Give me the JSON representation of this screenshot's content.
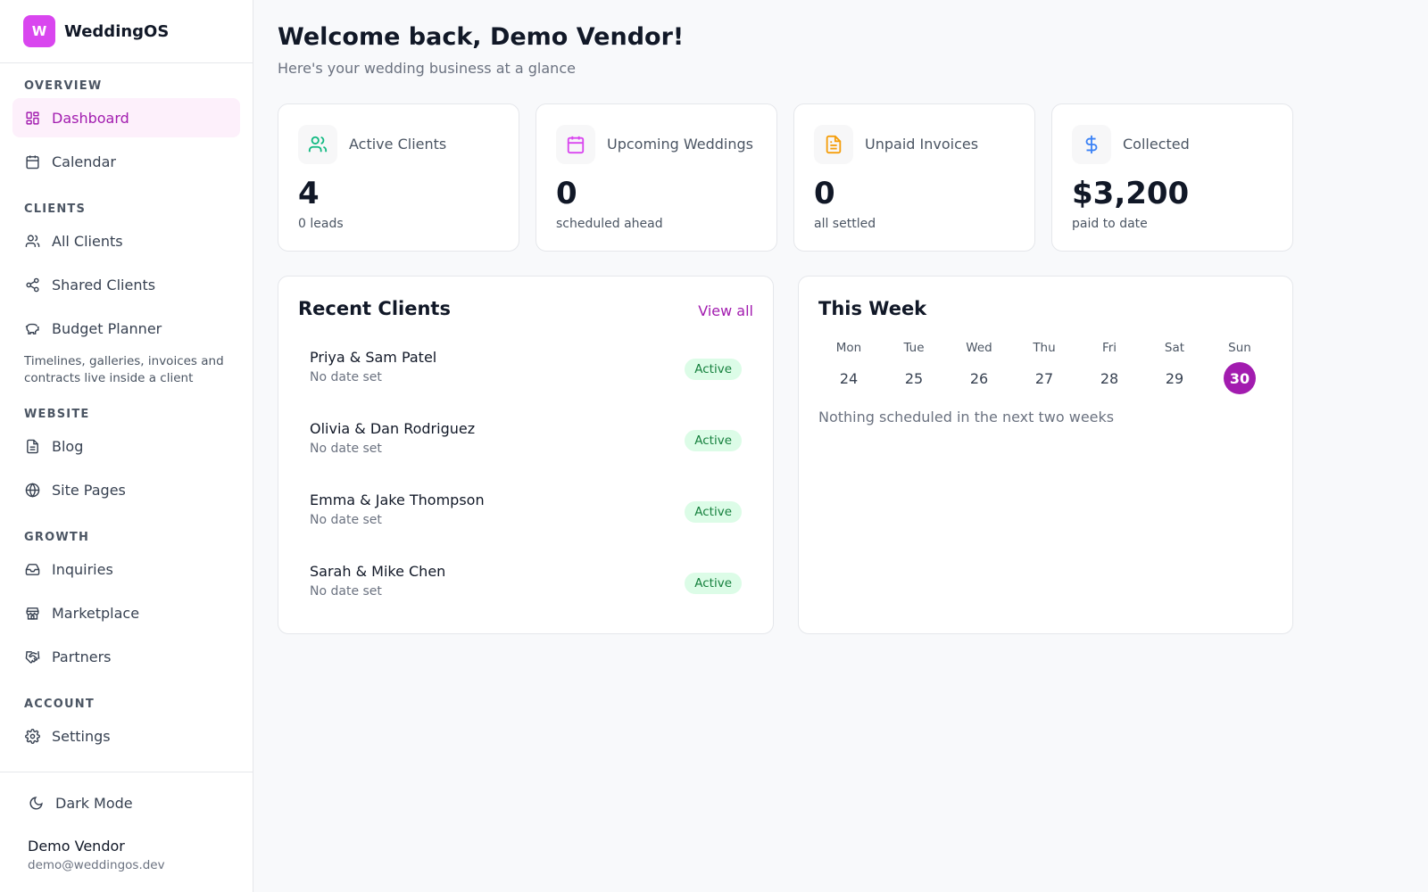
{
  "brand": {
    "logo_letter": "W",
    "name": "WeddingOS",
    "accent": "#d946ef"
  },
  "sidebar": {
    "sections": {
      "overview": "OVERVIEW",
      "clients": "CLIENTS",
      "website": "WEBSITE",
      "growth": "GROWTH",
      "account": "ACCOUNT"
    },
    "items": {
      "dashboard": {
        "label": "Dashboard",
        "icon": "dashboard-grid-icon",
        "active": true
      },
      "calendar": {
        "label": "Calendar",
        "icon": "calendar-icon"
      },
      "all_clients": {
        "label": "All Clients",
        "icon": "users-icon"
      },
      "shared_clients": {
        "label": "Shared Clients",
        "icon": "share-icon"
      },
      "budget_planner": {
        "label": "Budget Planner",
        "icon": "piggy-bank-icon"
      },
      "blog": {
        "label": "Blog",
        "icon": "document-icon"
      },
      "site_pages": {
        "label": "Site Pages",
        "icon": "globe-icon"
      },
      "inquiries": {
        "label": "Inquiries",
        "icon": "inbox-icon"
      },
      "marketplace": {
        "label": "Marketplace",
        "icon": "store-icon"
      },
      "partners": {
        "label": "Partners",
        "icon": "handshake-icon"
      },
      "settings": {
        "label": "Settings",
        "icon": "gear-icon"
      }
    },
    "note": "Timelines, galleries, invoices and contracts live inside a client",
    "dark_mode": {
      "label": "Dark Mode",
      "icon": "moon-icon"
    },
    "user": {
      "name": "Demo Vendor",
      "email": "demo@weddingos.dev"
    }
  },
  "header": {
    "title": "Welcome back, Demo Vendor!",
    "subtitle": "Here's your wedding business at a glance"
  },
  "stats": [
    {
      "label": "Active Clients",
      "value": "4",
      "sub": "0 leads",
      "icon": "users-icon",
      "color": "#10b981"
    },
    {
      "label": "Upcoming Weddings",
      "value": "0",
      "sub": "scheduled ahead",
      "icon": "calendar-icon",
      "color": "#d946ef"
    },
    {
      "label": "Unpaid Invoices",
      "value": "0",
      "sub": "all settled",
      "icon": "invoice-icon",
      "color": "#f59e0b"
    },
    {
      "label": "Collected",
      "value": "$3,200",
      "sub": "paid to date",
      "icon": "dollar-icon",
      "color": "#3b82f6"
    }
  ],
  "recent_clients": {
    "title": "Recent Clients",
    "view_all": "View all",
    "rows": [
      {
        "name": "Priya & Sam Patel",
        "date": "No date set",
        "status": "Active"
      },
      {
        "name": "Olivia & Dan Rodriguez",
        "date": "No date set",
        "status": "Active"
      },
      {
        "name": "Emma & Jake Thompson",
        "date": "No date set",
        "status": "Active"
      },
      {
        "name": "Sarah & Mike Chen",
        "date": "No date set",
        "status": "Active"
      }
    ]
  },
  "this_week": {
    "title": "This Week",
    "days": [
      {
        "name": "Mon",
        "num": "24"
      },
      {
        "name": "Tue",
        "num": "25"
      },
      {
        "name": "Wed",
        "num": "26"
      },
      {
        "name": "Thu",
        "num": "27"
      },
      {
        "name": "Fri",
        "num": "28"
      },
      {
        "name": "Sat",
        "num": "29"
      },
      {
        "name": "Sun",
        "num": "30",
        "today": true
      }
    ],
    "empty": "Nothing scheduled in the next two weeks"
  }
}
